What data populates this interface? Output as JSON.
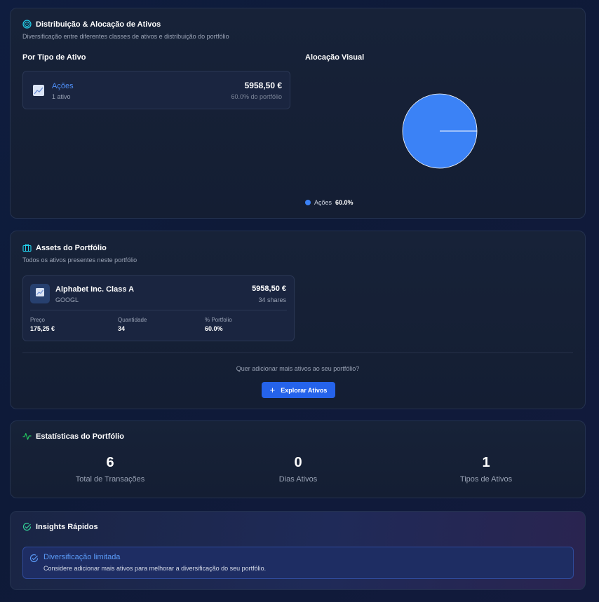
{
  "distribution": {
    "title": "Distribuição & Alocação de Ativos",
    "subtitle": "Diversificação entre diferentes classes de ativos e distribuição do portfólio",
    "by_type_heading": "Por Tipo de Ativo",
    "visual_heading": "Alocação Visual",
    "types": [
      {
        "name": "Ações",
        "count": "1 ativo",
        "value": "5958,50 €",
        "percent": "60.0% do portfólio"
      }
    ],
    "legend": [
      {
        "label": "Ações",
        "value": "60.0%",
        "color": "#3b82f6"
      }
    ]
  },
  "assets": {
    "title": "Assets do Portfólio",
    "subtitle": "Todos os ativos presentes neste portfólio",
    "items": [
      {
        "name": "Alphabet Inc. Class A",
        "ticker": "GOOGL",
        "value": "5958,50 €",
        "shares": "34 shares",
        "price_label": "Preço",
        "price": "175,25 €",
        "qty_label": "Quantidade",
        "qty": "34",
        "pct_label": "% Portfolio",
        "pct": "60.0%"
      }
    ],
    "explore_question": "Quer adicionar mais ativos ao seu portfólio?",
    "explore_button": "Explorar Ativos"
  },
  "stats": {
    "title": "Estatísticas do Portfólio",
    "items": [
      {
        "value": "6",
        "label": "Total de Transações"
      },
      {
        "value": "0",
        "label": "Dias Ativos"
      },
      {
        "value": "1",
        "label": "Tipos de Ativos"
      }
    ]
  },
  "insights": {
    "title": "Insights Rápidos",
    "items": [
      {
        "title": "Diversificação limitada",
        "description": "Considere adicionar mais ativos para melhorar a diversificação do seu portfólio."
      }
    ]
  },
  "colors": {
    "accent": "#3b82f6",
    "button": "#2563eb",
    "stats_icon": "#22c55e",
    "insights_icon": "#34d399"
  },
  "chart_data": {
    "type": "pie",
    "categories": [
      "Ações"
    ],
    "values": [
      100
    ],
    "colors": [
      "#3b82f6"
    ]
  }
}
